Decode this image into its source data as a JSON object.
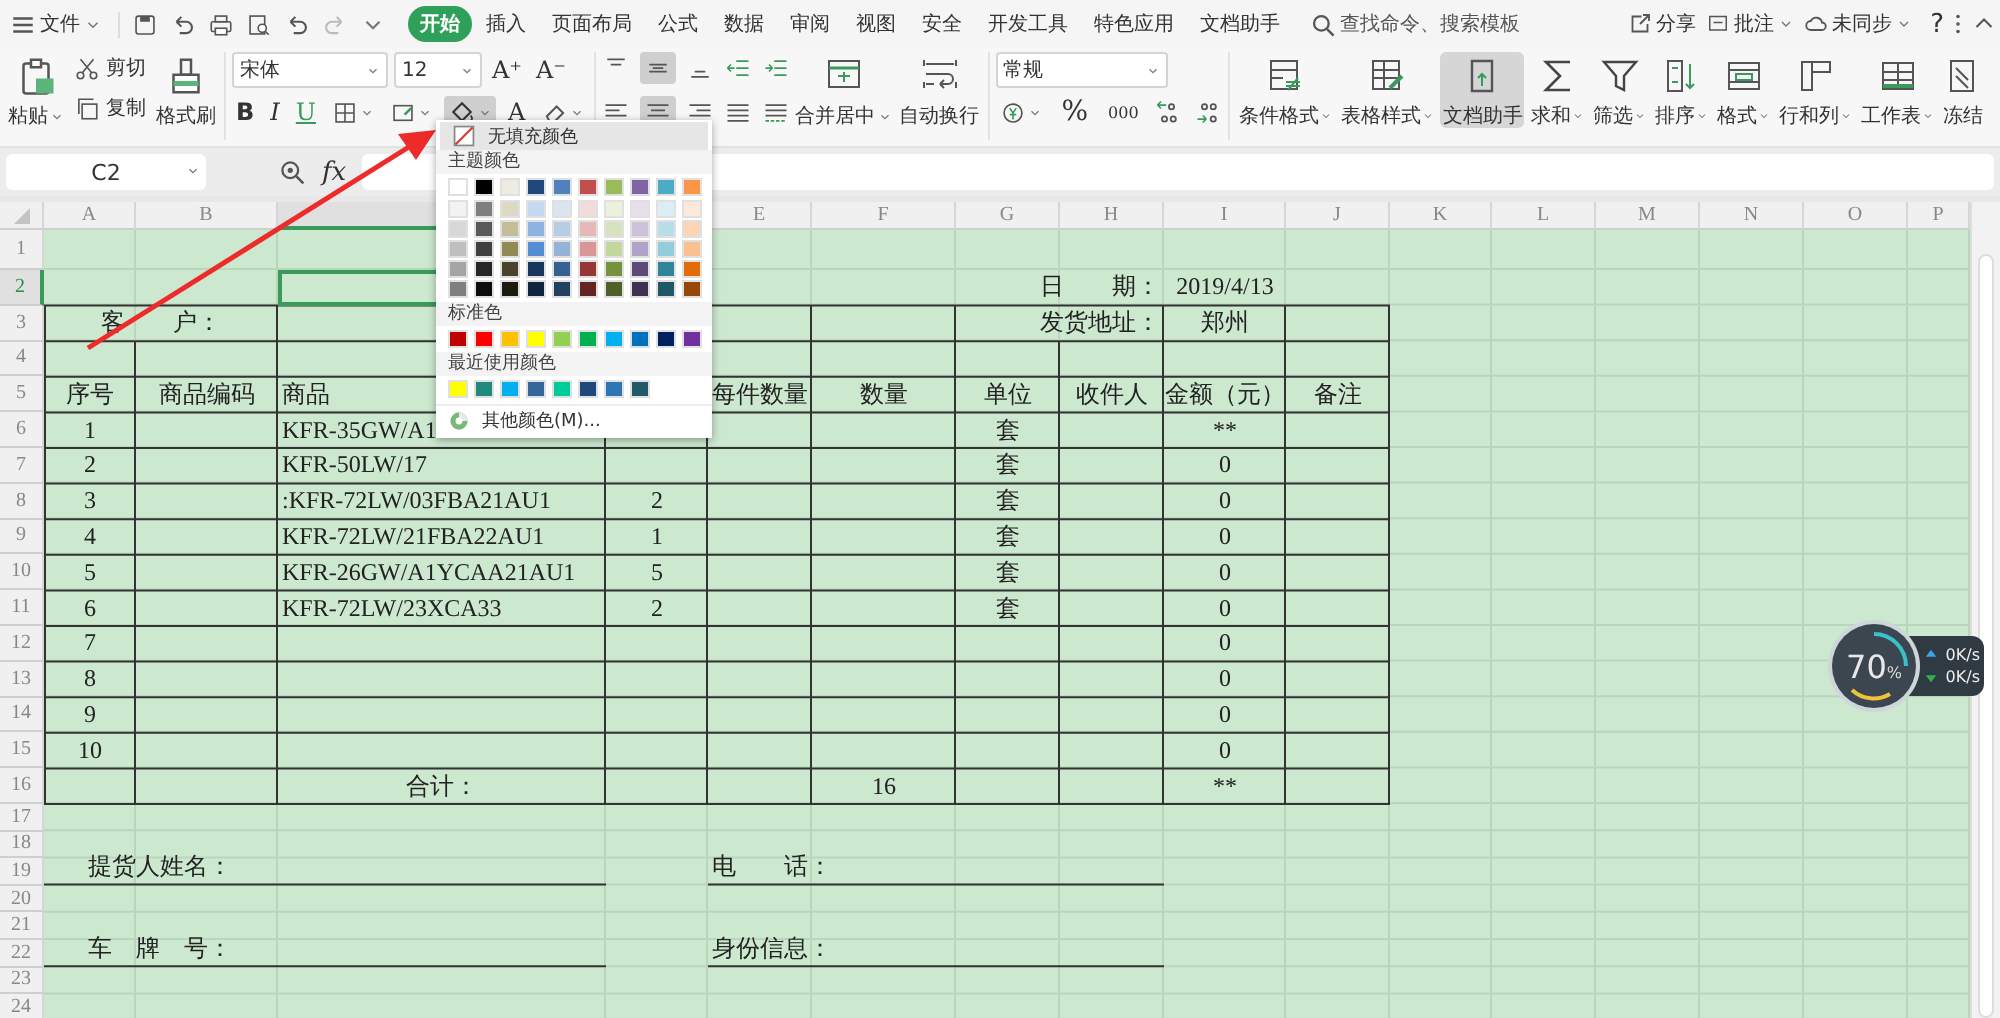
{
  "menubar": {
    "file": "文件",
    "tabs": [
      {
        "label": "开始",
        "selected": true
      },
      {
        "label": "插入",
        "selected": false
      },
      {
        "label": "页面布局",
        "selected": false
      },
      {
        "label": "公式",
        "selected": false
      },
      {
        "label": "数据",
        "selected": false
      },
      {
        "label": "审阅",
        "selected": false
      },
      {
        "label": "视图",
        "selected": false
      },
      {
        "label": "安全",
        "selected": false
      },
      {
        "label": "开发工具",
        "selected": false
      },
      {
        "label": "特色应用",
        "selected": false
      },
      {
        "label": "文档助手",
        "selected": false
      }
    ],
    "search": {
      "placeholder": "查找命令、搜索模板"
    },
    "actions": [
      {
        "label": "分享",
        "dropdown": false
      },
      {
        "label": "批注",
        "dropdown": true
      },
      {
        "label": "未同步",
        "dropdown": true
      }
    ],
    "help": "?"
  },
  "ribbon": {
    "paste": "粘贴",
    "cut": "剪切",
    "copy": "复制",
    "format_painter": "格式刷",
    "font": {
      "name": "宋体",
      "size": "12",
      "grow": "A⁺",
      "shrink": "A⁻",
      "bold": "B",
      "italic": "I",
      "underline": "U",
      "font_color": "A"
    },
    "fill_button": {
      "selected": true
    },
    "merge": "合并居中",
    "wrap": "自动换行",
    "number_format": "常规",
    "percent": "%",
    "thousands": "000",
    "big": [
      {
        "label": "条件格式",
        "dropdown": true,
        "selected": false
      },
      {
        "label": "表格样式",
        "dropdown": true,
        "selected": false
      },
      {
        "label": "文档助手",
        "dropdown": false,
        "selected": true
      },
      {
        "label": "求和",
        "dropdown": true,
        "selected": false
      },
      {
        "label": "筛选",
        "dropdown": true,
        "selected": false
      },
      {
        "label": "排序",
        "dropdown": true,
        "selected": false
      },
      {
        "label": "格式",
        "dropdown": true,
        "selected": false
      },
      {
        "label": "行和列",
        "dropdown": true,
        "selected": false
      },
      {
        "label": "工作表",
        "dropdown": true,
        "selected": false
      },
      {
        "label": "冻结",
        "dropdown": false,
        "selected": false
      }
    ]
  },
  "formula_bar": {
    "name_box": "C2",
    "fx": "fx"
  },
  "sheet": {
    "columns": [
      {
        "label": "A",
        "selected": false
      },
      {
        "label": "B",
        "selected": false
      },
      {
        "selected": true
      },
      {},
      {
        "label": "E",
        "selected": false
      },
      {
        "label": "F",
        "selected": false
      },
      {
        "label": "G",
        "selected": false
      },
      {
        "label": "H",
        "selected": false
      },
      {
        "label": "I",
        "selected": false
      },
      {
        "label": "J",
        "selected": false
      },
      {
        "label": "K",
        "selected": false
      },
      {
        "label": "L",
        "selected": false
      },
      {
        "label": "M",
        "selected": false
      },
      {
        "label": "N",
        "selected": false
      },
      {
        "label": "O",
        "selected": false
      },
      {
        "label": "P",
        "selected": false
      }
    ],
    "rows": [
      {
        "label": "1",
        "selected": false
      },
      {
        "label": "2",
        "selected": true,
        "G": "日　　期：",
        "I": "2019/4/13"
      },
      {
        "label": "3",
        "selected": false,
        "A": "客　　户：",
        "G": "发货地址：",
        "I": "郑州"
      },
      {
        "label": "4",
        "selected": false
      },
      {
        "label": "5",
        "selected": false,
        "A": "序号",
        "B": "商品编码",
        "C": "商品",
        "E": "每件数量",
        "F": "数量",
        "G": "单位",
        "H": "收件人",
        "I": "金额（元）",
        "J": "备注"
      },
      {
        "label": "6",
        "selected": false,
        "A": "1",
        "C": "KFR-35GW/A1",
        "G": "套",
        "I": "**"
      },
      {
        "label": "7",
        "selected": false,
        "A": "2",
        "C": "KFR-50LW/17",
        "G": "套",
        "I": "0"
      },
      {
        "label": "8",
        "selected": false,
        "A": "3",
        "C": ":KFR-72LW/03FBA21AU1",
        "D": "2",
        "G": "套",
        "I": "0"
      },
      {
        "label": "9",
        "selected": false,
        "A": "4",
        "C": "KFR-72LW/21FBA22AU1",
        "D": "1",
        "G": "套",
        "I": "0"
      },
      {
        "label": "10",
        "selected": false,
        "A": "5",
        "C": "KFR-26GW/A1YCAA21AU1",
        "D": "5",
        "G": "套",
        "I": "0"
      },
      {
        "label": "11",
        "selected": false,
        "A": "6",
        "C": "KFR-72LW/23XCA33",
        "D": "2",
        "G": "套",
        "I": "0"
      },
      {
        "label": "12",
        "selected": false,
        "A": "7",
        "I": "0"
      },
      {
        "label": "13",
        "selected": false,
        "A": "8",
        "I": "0"
      },
      {
        "label": "14",
        "selected": false,
        "A": "9",
        "I": "0"
      },
      {
        "label": "15",
        "selected": false,
        "A": "10",
        "I": "0"
      },
      {
        "label": "16",
        "selected": false,
        "C": "合计：",
        "F": "16",
        "I": "**"
      },
      {
        "label": "17",
        "selected": false
      },
      {
        "label": "18",
        "selected": false
      },
      {
        "label": "19",
        "selected": false,
        "A": "提货人姓名：",
        "E": "电　　话："
      },
      {
        "label": "20",
        "selected": false
      },
      {
        "label": "21",
        "selected": false
      },
      {
        "label": "22",
        "selected": false,
        "A": "车　牌　号：",
        "E": "身份信息："
      },
      {
        "label": "23",
        "selected": false
      },
      {
        "label": "24",
        "selected": false
      }
    ]
  },
  "fill_menu": {
    "no_fill": {
      "label": "无填充颜色",
      "highlighted": true
    },
    "theme_title": "主题颜色",
    "theme": [
      {
        "color": "#ffffff"
      },
      {
        "color": "#000000"
      },
      {
        "color": "#eeece1"
      },
      {
        "color": "#1f497d"
      },
      {
        "color": "#4f81bd"
      },
      {
        "color": "#c0504d"
      },
      {
        "color": "#9bbb59"
      },
      {
        "color": "#8064a2"
      },
      {
        "color": "#4bacc6"
      },
      {
        "color": "#f79646"
      }
    ],
    "tints": [
      [
        {
          "color": "#f2f2f2"
        },
        {
          "color": "#7f7f7f"
        },
        {
          "color": "#ddd9c3"
        },
        {
          "color": "#c6d9f0"
        },
        {
          "color": "#dbe5f1"
        },
        {
          "color": "#f2dcdb"
        },
        {
          "color": "#ebf1dd"
        },
        {
          "color": "#e5e0ec"
        },
        {
          "color": "#dbeef3"
        },
        {
          "color": "#fdeada"
        }
      ],
      [
        {
          "color": "#d8d8d8"
        },
        {
          "color": "#595959"
        },
        {
          "color": "#c4bd97"
        },
        {
          "color": "#8db3e2"
        },
        {
          "color": "#b8cce4"
        },
        {
          "color": "#e5b9b7"
        },
        {
          "color": "#d7e3bc"
        },
        {
          "color": "#ccc1d9"
        },
        {
          "color": "#b7dde8"
        },
        {
          "color": "#fbd5b5"
        }
      ],
      [
        {
          "color": "#bfbfbf"
        },
        {
          "color": "#3f3f3f"
        },
        {
          "color": "#938953"
        },
        {
          "color": "#548dd4"
        },
        {
          "color": "#95b3d7"
        },
        {
          "color": "#d99694"
        },
        {
          "color": "#c3d69b"
        },
        {
          "color": "#b2a2c7"
        },
        {
          "color": "#92cddc"
        },
        {
          "color": "#fac08f"
        }
      ],
      [
        {
          "color": "#a5a5a5"
        },
        {
          "color": "#262626"
        },
        {
          "color": "#494429"
        },
        {
          "color": "#17365d"
        },
        {
          "color": "#366092"
        },
        {
          "color": "#953734"
        },
        {
          "color": "#76923c"
        },
        {
          "color": "#5f497a"
        },
        {
          "color": "#31859b"
        },
        {
          "color": "#e36c09"
        }
      ],
      [
        {
          "color": "#7f7f7f"
        },
        {
          "color": "#0c0c0c"
        },
        {
          "color": "#1d1b10"
        },
        {
          "color": "#0f243e"
        },
        {
          "color": "#244061"
        },
        {
          "color": "#632423"
        },
        {
          "color": "#4f6128"
        },
        {
          "color": "#3f3151"
        },
        {
          "color": "#205867"
        },
        {
          "color": "#974806"
        }
      ]
    ],
    "standard_title": "标准色",
    "standard": [
      {
        "color": "#c00000"
      },
      {
        "color": "#ff0000"
      },
      {
        "color": "#ffc000"
      },
      {
        "color": "#ffff00"
      },
      {
        "color": "#92d050"
      },
      {
        "color": "#00b050"
      },
      {
        "color": "#00b0f0"
      },
      {
        "color": "#0070c0"
      },
      {
        "color": "#002060"
      },
      {
        "color": "#7030a0"
      }
    ],
    "recent_title": "最近使用颜色",
    "recent": [
      {
        "color": "#ffff00"
      },
      {
        "color": "#1f8a7a"
      },
      {
        "color": "#00b0f0"
      },
      {
        "color": "#336699"
      },
      {
        "color": "#00cc99"
      },
      {
        "color": "#1f497d"
      },
      {
        "color": "#2e75b6"
      },
      {
        "color": "#215968"
      }
    ],
    "more": "其他颜色(M)..."
  },
  "net_monitor": {
    "percent": "70",
    "unit": "%",
    "upload": "0K/s",
    "download": "0K/s"
  }
}
